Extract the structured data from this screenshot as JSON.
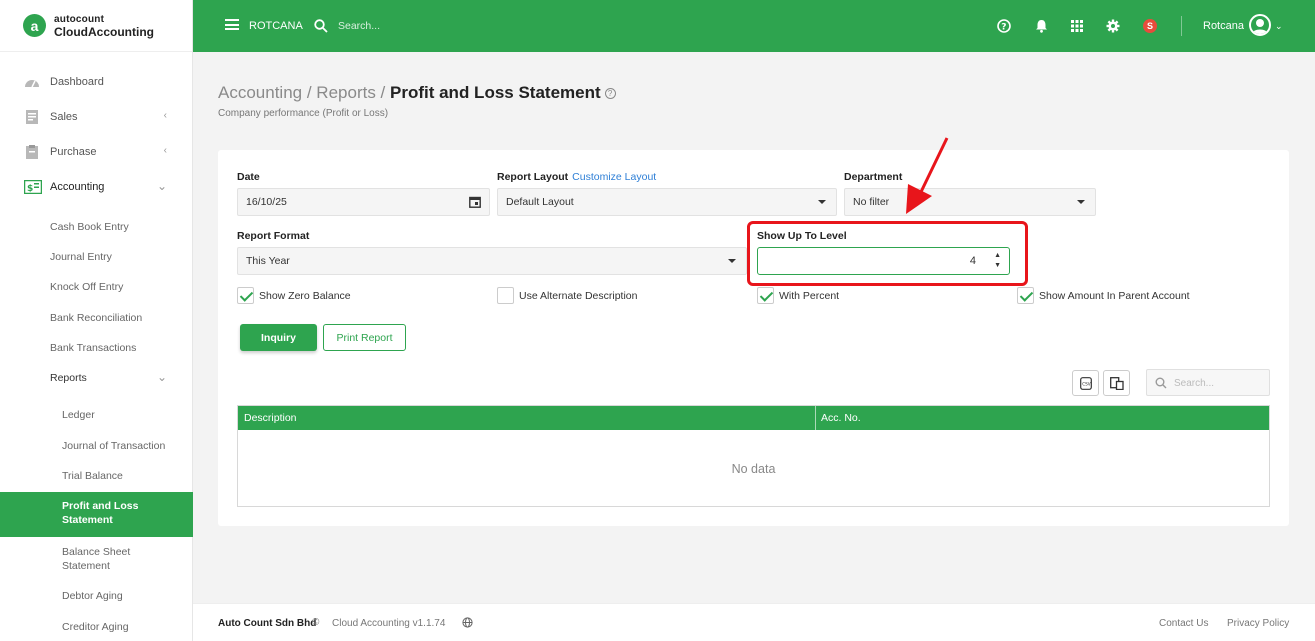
{
  "brand": {
    "small": "autocount",
    "big": "CloudAccounting",
    "logo_letter": "a"
  },
  "topbar": {
    "company": "ROTCANA",
    "search_placeholder": "Search...",
    "badge": "S",
    "user": "Rotcana"
  },
  "sidebar": {
    "items": [
      {
        "label": "Dashboard",
        "icon": "dashboard-icon"
      },
      {
        "label": "Sales",
        "icon": "sales-icon",
        "chevron": "‹"
      },
      {
        "label": "Purchase",
        "icon": "purchase-icon",
        "chevron": "‹"
      },
      {
        "label": "Accounting",
        "icon": "accounting-icon",
        "chevron": "⌄"
      }
    ],
    "accounting_sub": [
      "Cash Book Entry",
      "Journal Entry",
      "Knock Off Entry",
      "Bank Reconciliation",
      "Bank Transactions",
      "Reports"
    ],
    "reports_chevron": "⌄",
    "reports_sub": [
      "Ledger",
      "Journal of Transaction",
      "Trial Balance",
      "Profit and Loss Statement",
      "Balance Sheet Statement",
      "Debtor Aging",
      "Creditor Aging"
    ]
  },
  "header": {
    "crumb1": "Accounting",
    "sep": " / ",
    "crumb2": "Reports",
    "current": "Profit and Loss Statement",
    "subtitle": "Company performance (Profit or Loss)"
  },
  "form": {
    "date_label": "Date",
    "date_value": "16/10/25",
    "layout_label": "Report Layout",
    "customize_link": "Customize Layout",
    "layout_value": "Default Layout",
    "department_label": "Department",
    "department_value": "No filter",
    "format_label": "Report Format",
    "format_value": "This Year",
    "level_label": "Show Up To Level",
    "level_value": "4",
    "checks": [
      {
        "label": "Show Zero Balance",
        "checked": true
      },
      {
        "label": "Use Alternate Description",
        "checked": false
      },
      {
        "label": "With Percent",
        "checked": true
      },
      {
        "label": "Show Amount In Parent Account",
        "checked": true
      }
    ],
    "inquiry_label": "Inquiry",
    "print_label": "Print Report"
  },
  "table": {
    "search_placeholder": "Search...",
    "col_description": "Description",
    "col_acc_no": "Acc. No.",
    "empty": "No data"
  },
  "footer": {
    "company": "Auto Count Sdn Bhd",
    "copyright": "©",
    "version": "Cloud Accounting v1.1.74",
    "contact": "Contact Us",
    "privacy": "Privacy Policy"
  },
  "colors": {
    "brand_green": "#2ea44f",
    "highlight_red": "#e8151b",
    "link_blue": "#2e7fd6"
  }
}
